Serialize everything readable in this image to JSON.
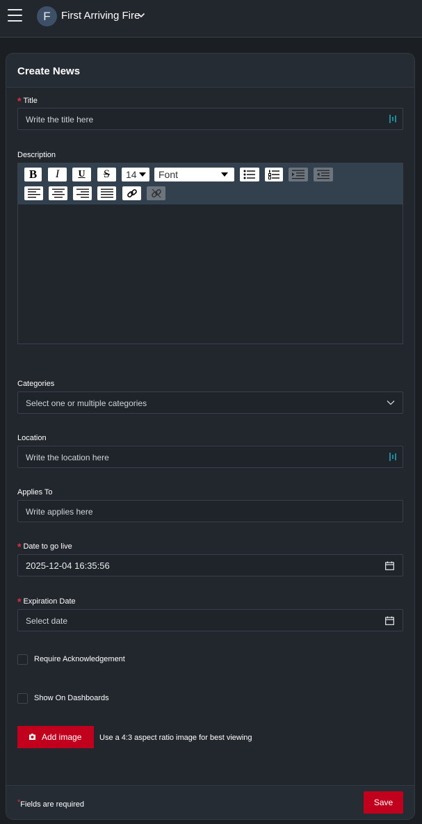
{
  "topbar": {
    "org_initial": "F",
    "org_name": "First Arriving Fire"
  },
  "form": {
    "title": "Create News",
    "fields": {
      "title": {
        "label": "Title",
        "required": true,
        "placeholder": "Write the title here"
      },
      "description": {
        "label": "Description"
      },
      "categories": {
        "label": "Categories",
        "placeholder": "Select one or multiple categories"
      },
      "location": {
        "label": "Location",
        "placeholder": "Write the location here"
      },
      "applies_to": {
        "label": "Applies To",
        "placeholder": "Write applies here"
      },
      "date_live": {
        "label": "Date to go live",
        "required": true,
        "value": "2025-12-04 16:35:56"
      },
      "expiration": {
        "label": "Expiration Date",
        "required": true,
        "placeholder": "Select date"
      }
    },
    "editor_toolbar": {
      "font_size": "14",
      "font_family": "Font",
      "buttons": [
        "bold",
        "italic",
        "underline",
        "strikethrough",
        "bullet-list",
        "numbered-list",
        "indent",
        "outdent",
        "align-left",
        "align-center",
        "align-right",
        "justify",
        "link",
        "unlink"
      ]
    },
    "checkboxes": {
      "require_ack": "Require Acknowledgement",
      "show_dashboards": "Show On Dashboards"
    },
    "add_image": {
      "label": "Add image",
      "hint": "Use a 4:3 aspect ratio image for best viewing"
    },
    "footer": {
      "required_marker": "*",
      "required_note": "Fields are required",
      "save_label": "Save"
    }
  },
  "colors": {
    "accent": "#c0001d",
    "required": "#e0303e",
    "background": "#1b1e22",
    "card": "#22272e"
  }
}
